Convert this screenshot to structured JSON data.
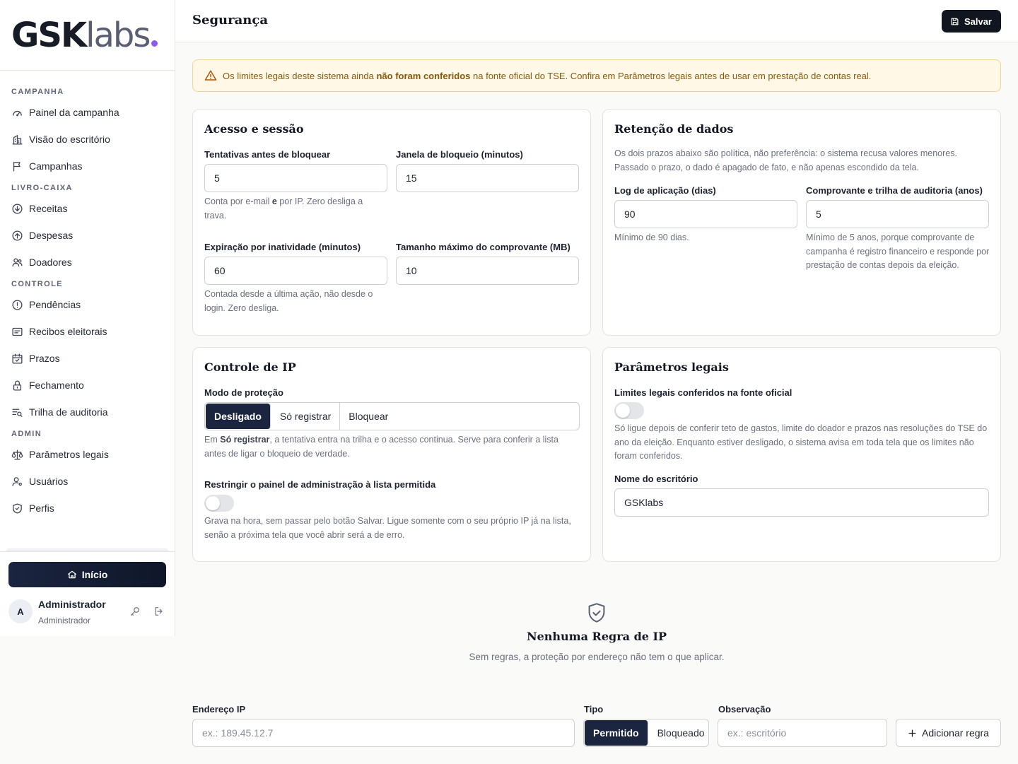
{
  "brand": {
    "bold": "GSK",
    "light": "labs"
  },
  "sidebar": {
    "sections": [
      {
        "title": "CAMPANHA",
        "items": [
          {
            "label": "Painel da campanha",
            "icon": "gauge-icon"
          },
          {
            "label": "Visão do escritório",
            "icon": "building-icon"
          },
          {
            "label": "Campanhas",
            "icon": "flag-icon"
          }
        ]
      },
      {
        "title": "LIVRO-CAIXA",
        "items": [
          {
            "label": "Receitas",
            "icon": "arrow-down-circle-icon"
          },
          {
            "label": "Despesas",
            "icon": "arrow-up-circle-icon"
          },
          {
            "label": "Doadores",
            "icon": "users-icon"
          }
        ]
      },
      {
        "title": "CONTROLE",
        "items": [
          {
            "label": "Pendências",
            "icon": "alert-circle-icon"
          },
          {
            "label": "Recibos eleitorais",
            "icon": "receipt-icon"
          },
          {
            "label": "Prazos",
            "icon": "calendar-check-icon"
          },
          {
            "label": "Fechamento",
            "icon": "lock-icon"
          },
          {
            "label": "Trilha de auditoria",
            "icon": "list-search-icon"
          }
        ]
      },
      {
        "title": "ADMIN",
        "items": [
          {
            "label": "Parâmetros legais",
            "icon": "scale-icon"
          },
          {
            "label": "Usuários",
            "icon": "user-gear-icon"
          },
          {
            "label": "Perfis",
            "icon": "shield-check-icon"
          }
        ]
      }
    ],
    "home_label": "Início",
    "user": {
      "initial": "A",
      "name": "Administrador",
      "role": "Administrador"
    }
  },
  "header": {
    "title": "Segurança",
    "save_label": "Salvar"
  },
  "alert": {
    "pre": "Os limites legais deste sistema ainda ",
    "bold": "não foram conferidos",
    "post": " na fonte oficial do TSE. Confira em Parâmetros legais antes de usar em prestação de contas real."
  },
  "access": {
    "title": "Acesso e sessão",
    "attempts": {
      "label": "Tentativas antes de bloquear",
      "value": "5",
      "help_pre": "Conta por e-mail ",
      "help_bold": "e",
      "help_post": " por IP. Zero desliga a trava."
    },
    "lock_window": {
      "label": "Janela de bloqueio (minutos)",
      "value": "15"
    },
    "idle": {
      "label": "Expiração por inatividade (minutos)",
      "value": "60",
      "help": "Contada desde a última ação, não desde o login. Zero desliga."
    },
    "max_size": {
      "label": "Tamanho máximo do comprovante (MB)",
      "value": "10"
    }
  },
  "retention": {
    "title": "Retenção de dados",
    "intro": "Os dois prazos abaixo são política, não preferência: o sistema recusa valores menores. Passado o prazo, o dado é apagado de fato, e não apenas escondido da tela.",
    "log": {
      "label": "Log de aplicação (dias)",
      "value": "90",
      "help": "Mínimo de 90 dias."
    },
    "receipts": {
      "label": "Comprovante e trilha de auditoria (anos)",
      "value": "5",
      "help": "Mínimo de 5 anos, porque comprovante de campanha é registro financeiro e responde por prestação de contas depois da eleição."
    }
  },
  "ip_control": {
    "title": "Controle de IP",
    "mode_label": "Modo de proteção",
    "modes": [
      "Desligado",
      "Só registrar",
      "Bloquear"
    ],
    "selected_mode": "Desligado",
    "mode_help_pre": "Em ",
    "mode_help_bold": "Só registrar",
    "mode_help_post": ", a tentativa entra na trilha e o acesso continua. Serve para conferir a lista antes de ligar o bloqueio de verdade.",
    "restrict_label": "Restringir o painel de administração à lista permitida",
    "restrict_on": false,
    "restrict_help": "Grava na hora, sem passar pelo botão Salvar. Ligue somente com o seu próprio IP já na lista, senão a próxima tela que você abrir será a de erro."
  },
  "legal": {
    "title": "Parâmetros legais",
    "checked_label": "Limites legais conferidos na fonte oficial",
    "checked_on": false,
    "checked_help": "Só ligue depois de conferir teto de gastos, limite do doador e prazos nas resoluções do TSE do ano da eleição. Enquanto estiver desligado, o sistema avisa em toda tela que os limites não foram conferidos.",
    "office_label": "Nome do escritório",
    "office_value": "GSKlabs"
  },
  "empty": {
    "title": "Nenhuma Regra de IP",
    "subtitle": "Sem regras, a proteção por endereço não tem o que aplicar."
  },
  "new_rule": {
    "ip_label": "Endereço IP",
    "ip_placeholder": "ex.: 189.45.12.7",
    "type_label": "Tipo",
    "types": [
      "Permitido",
      "Bloqueado"
    ],
    "selected_type": "Permitido",
    "note_label": "Observação",
    "note_placeholder": "ex.: escritório",
    "add_label": "Adicionar regra"
  },
  "colors": {
    "accent": "#1b2540",
    "brand_dot": "#8b5cf6",
    "warning_bg": "#fff8e6",
    "warning_text": "#8a5a0a"
  }
}
